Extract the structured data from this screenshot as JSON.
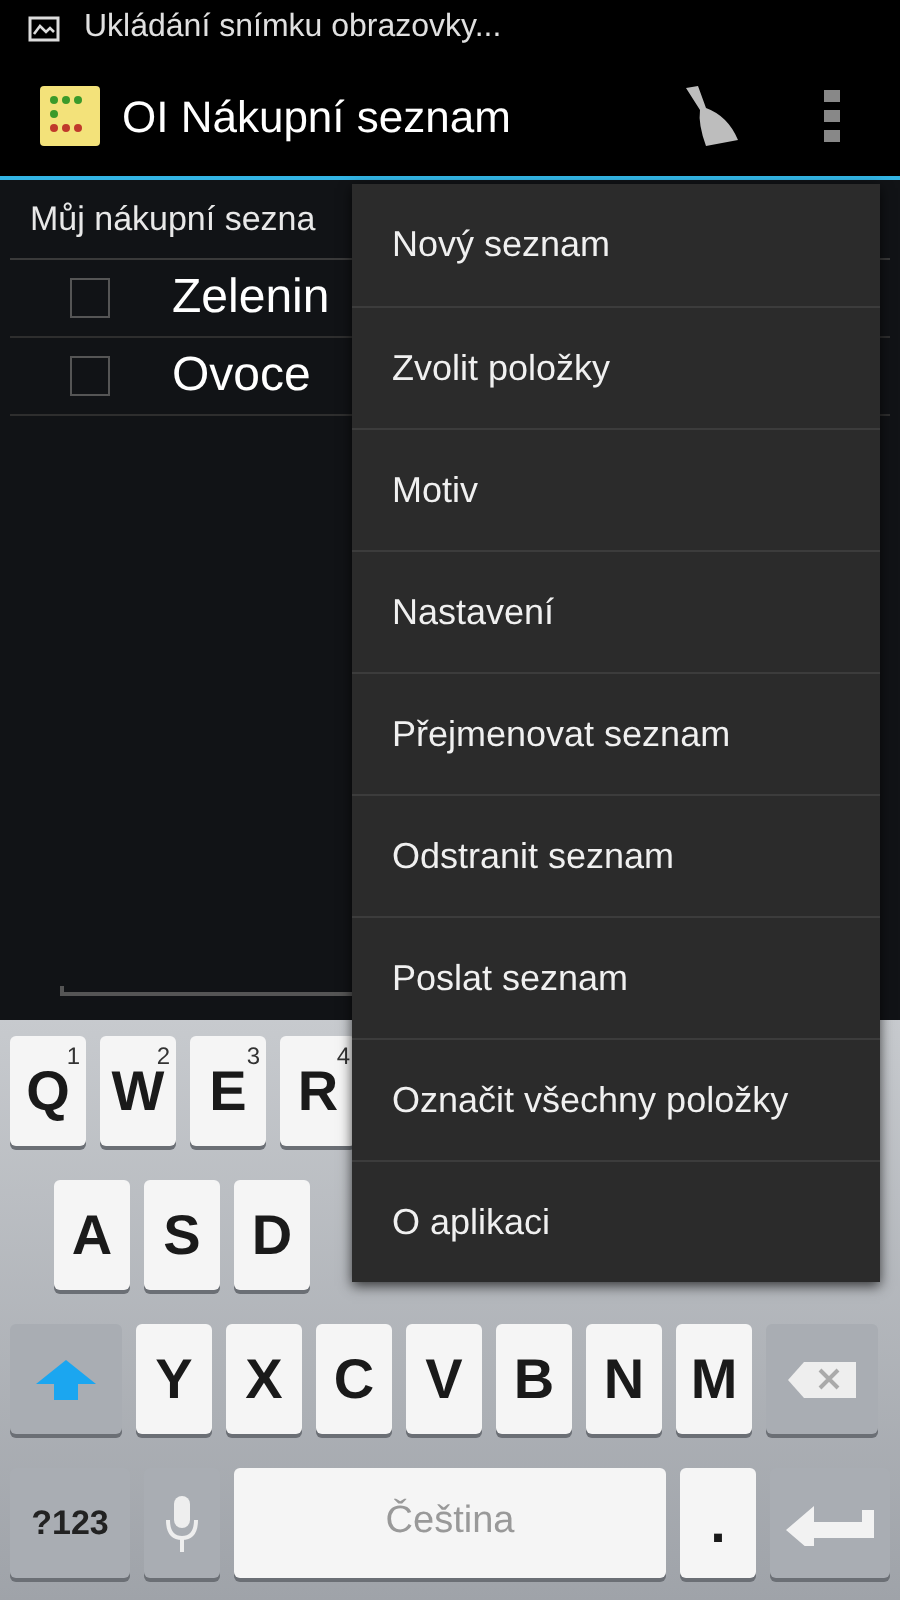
{
  "status_bar": {
    "notification": "Ukládání snímku obrazovky..."
  },
  "action_bar": {
    "title": "OI Nákupní seznam"
  },
  "list": {
    "name": "Můj nákupní sezna",
    "items": [
      {
        "label": "Zelenin",
        "checked": false
      },
      {
        "label": "Ovoce",
        "checked": false
      }
    ]
  },
  "menu": {
    "items": [
      "Nový seznam",
      "Zvolit položky",
      "Motiv",
      "Nastavení",
      "Přejmenovat seznam",
      "Odstranit seznam",
      "Poslat seznam",
      "Označit všechny položky",
      "O aplikaci"
    ]
  },
  "keyboard": {
    "rows": [
      {
        "keys": [
          {
            "kind": "letter",
            "label": "Q",
            "hint": "1"
          },
          {
            "kind": "letter",
            "label": "W",
            "hint": "2"
          },
          {
            "kind": "letter",
            "label": "E",
            "hint": "3"
          },
          {
            "kind": "letter",
            "label": "R",
            "hint": "4"
          }
        ]
      },
      {
        "keys": [
          {
            "kind": "letter",
            "label": "A"
          },
          {
            "kind": "letter",
            "label": "S"
          },
          {
            "kind": "letter",
            "label": "D"
          }
        ]
      },
      {
        "keys": [
          {
            "kind": "shift"
          },
          {
            "kind": "letter",
            "label": "Y"
          },
          {
            "kind": "letter",
            "label": "X"
          },
          {
            "kind": "letter",
            "label": "C"
          },
          {
            "kind": "letter",
            "label": "V"
          },
          {
            "kind": "letter",
            "label": "B"
          },
          {
            "kind": "letter",
            "label": "N"
          },
          {
            "kind": "letter",
            "label": "M"
          },
          {
            "kind": "backspace"
          }
        ]
      },
      {
        "keys": [
          {
            "kind": "symbols",
            "label": "?123"
          },
          {
            "kind": "mic"
          },
          {
            "kind": "space",
            "label": "Čeština"
          },
          {
            "kind": "letter",
            "label": "."
          },
          {
            "kind": "enter"
          }
        ]
      }
    ]
  }
}
